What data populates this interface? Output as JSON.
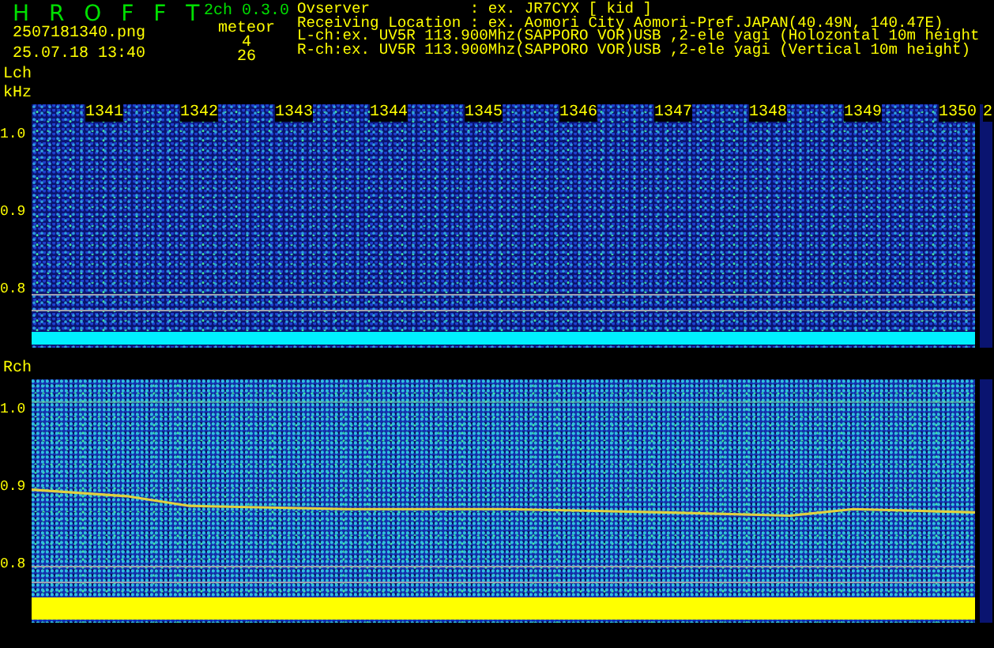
{
  "app": {
    "title": "H R O F F T",
    "version": "2ch 0.3.0"
  },
  "file": {
    "name": "2507181340.png",
    "datetime": "25.07.18 13:40"
  },
  "meteor": {
    "label": "meteor",
    "counts": [
      "4",
      "26"
    ]
  },
  "info_lines": [
    "Ovserver           : ex. JR7CYX [ kid ]",
    "Receiving Location : ex. Aomori City Aomori-Pref.JAPAN(40.49N, 140.47E)",
    "L-ch:ex. UV5R 113.900Mhz(SAPPORO VOR)USB ,2-ele yagi (Holozontal 10m height",
    "R-ch:ex. UV5R 113.900Mhz(SAPPORO VOR)USB ,2-ele yagi (Vertical 10m height)"
  ],
  "time_labels": [
    "1341",
    "1342",
    "1343",
    "1344",
    "1345",
    "1346",
    "1347",
    "1348",
    "1349",
    "1350",
    "2"
  ],
  "panels": [
    {
      "kind": "lch",
      "channel": "Lch",
      "unit": "kHz",
      "yticks": [
        "1.0",
        "0.9",
        "0.8"
      ]
    },
    {
      "kind": "rch",
      "channel": "Rch",
      "yticks": [
        "1.0",
        "0.9",
        "0.8"
      ]
    }
  ]
}
